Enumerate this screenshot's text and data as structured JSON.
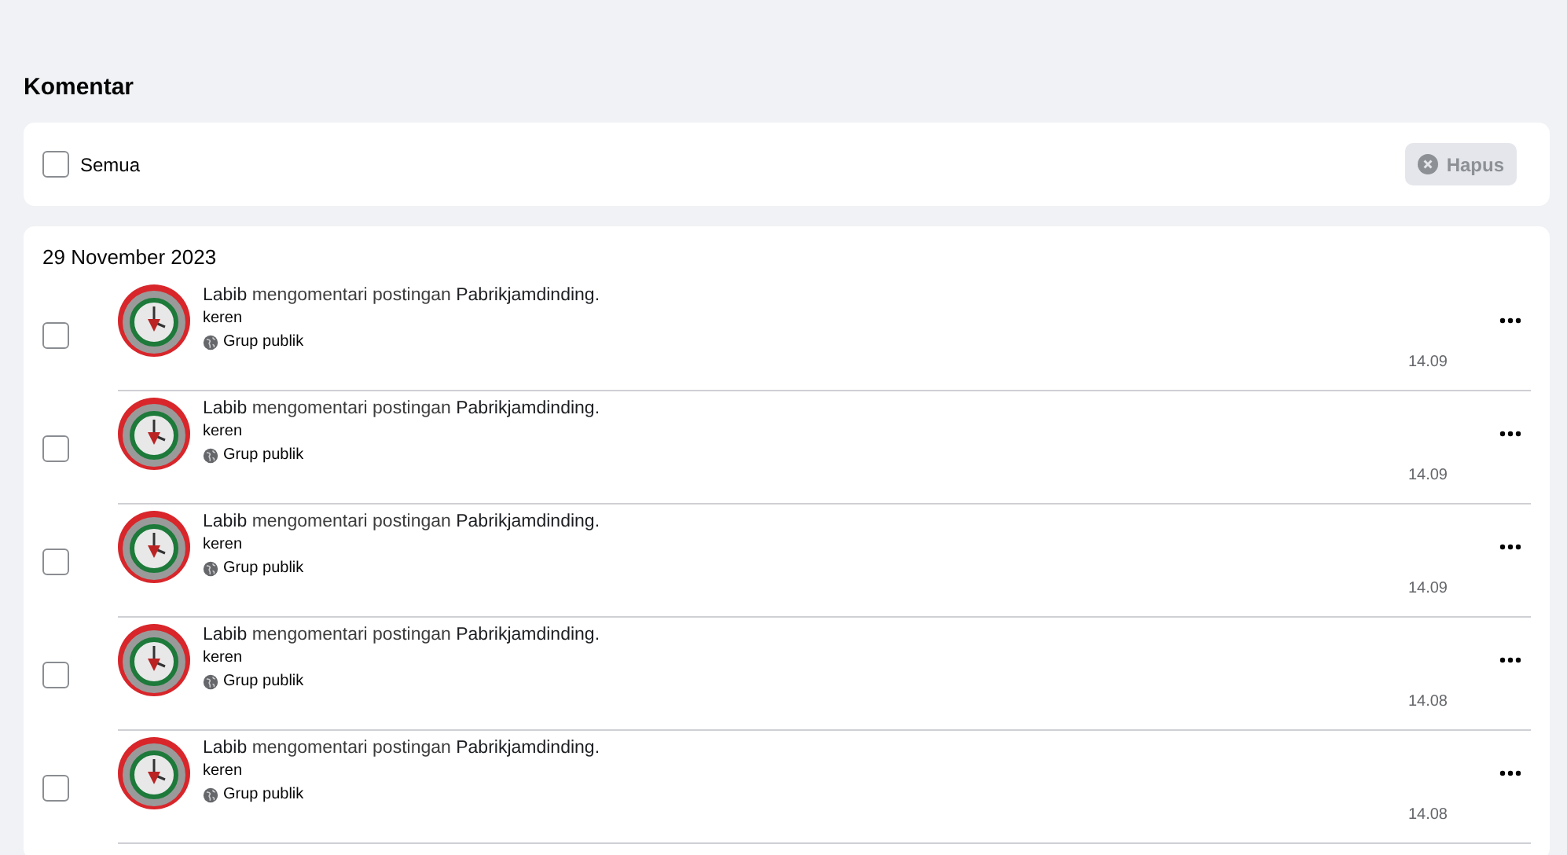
{
  "title": "Komentar",
  "toolbar": {
    "select_all": {
      "label": "Semua",
      "checked": false
    },
    "delete_button": {
      "label": "Hapus",
      "disabled": true
    }
  },
  "groups": [
    {
      "date": "29 November 2023",
      "items": [
        {
          "text": "**Labib** mengomentari postingan **Pabrikjamdinding.**",
          "comment": "keren",
          "audience": "Grup publik",
          "time": "14.09",
          "checked": false
        },
        {
          "text": "**Labib** mengomentari postingan **Pabrikjamdinding.**",
          "comment": "keren",
          "audience": "Grup publik",
          "time": "14.09",
          "checked": false
        },
        {
          "text": "**Labib** mengomentari postingan **Pabrikjamdinding.**",
          "comment": "keren",
          "audience": "Grup publik",
          "time": "14.09",
          "checked": false
        },
        {
          "text": "**Labib** mengomentari postingan **Pabrikjamdinding.**",
          "comment": "keren",
          "audience": "Grup publik",
          "time": "14.08",
          "checked": false
        },
        {
          "text": "**Labib** mengomentari postingan **Pabrikjamdinding.**",
          "comment": "keren",
          "audience": "Grup publik",
          "time": "14.08",
          "checked": false
        }
      ]
    }
  ]
}
